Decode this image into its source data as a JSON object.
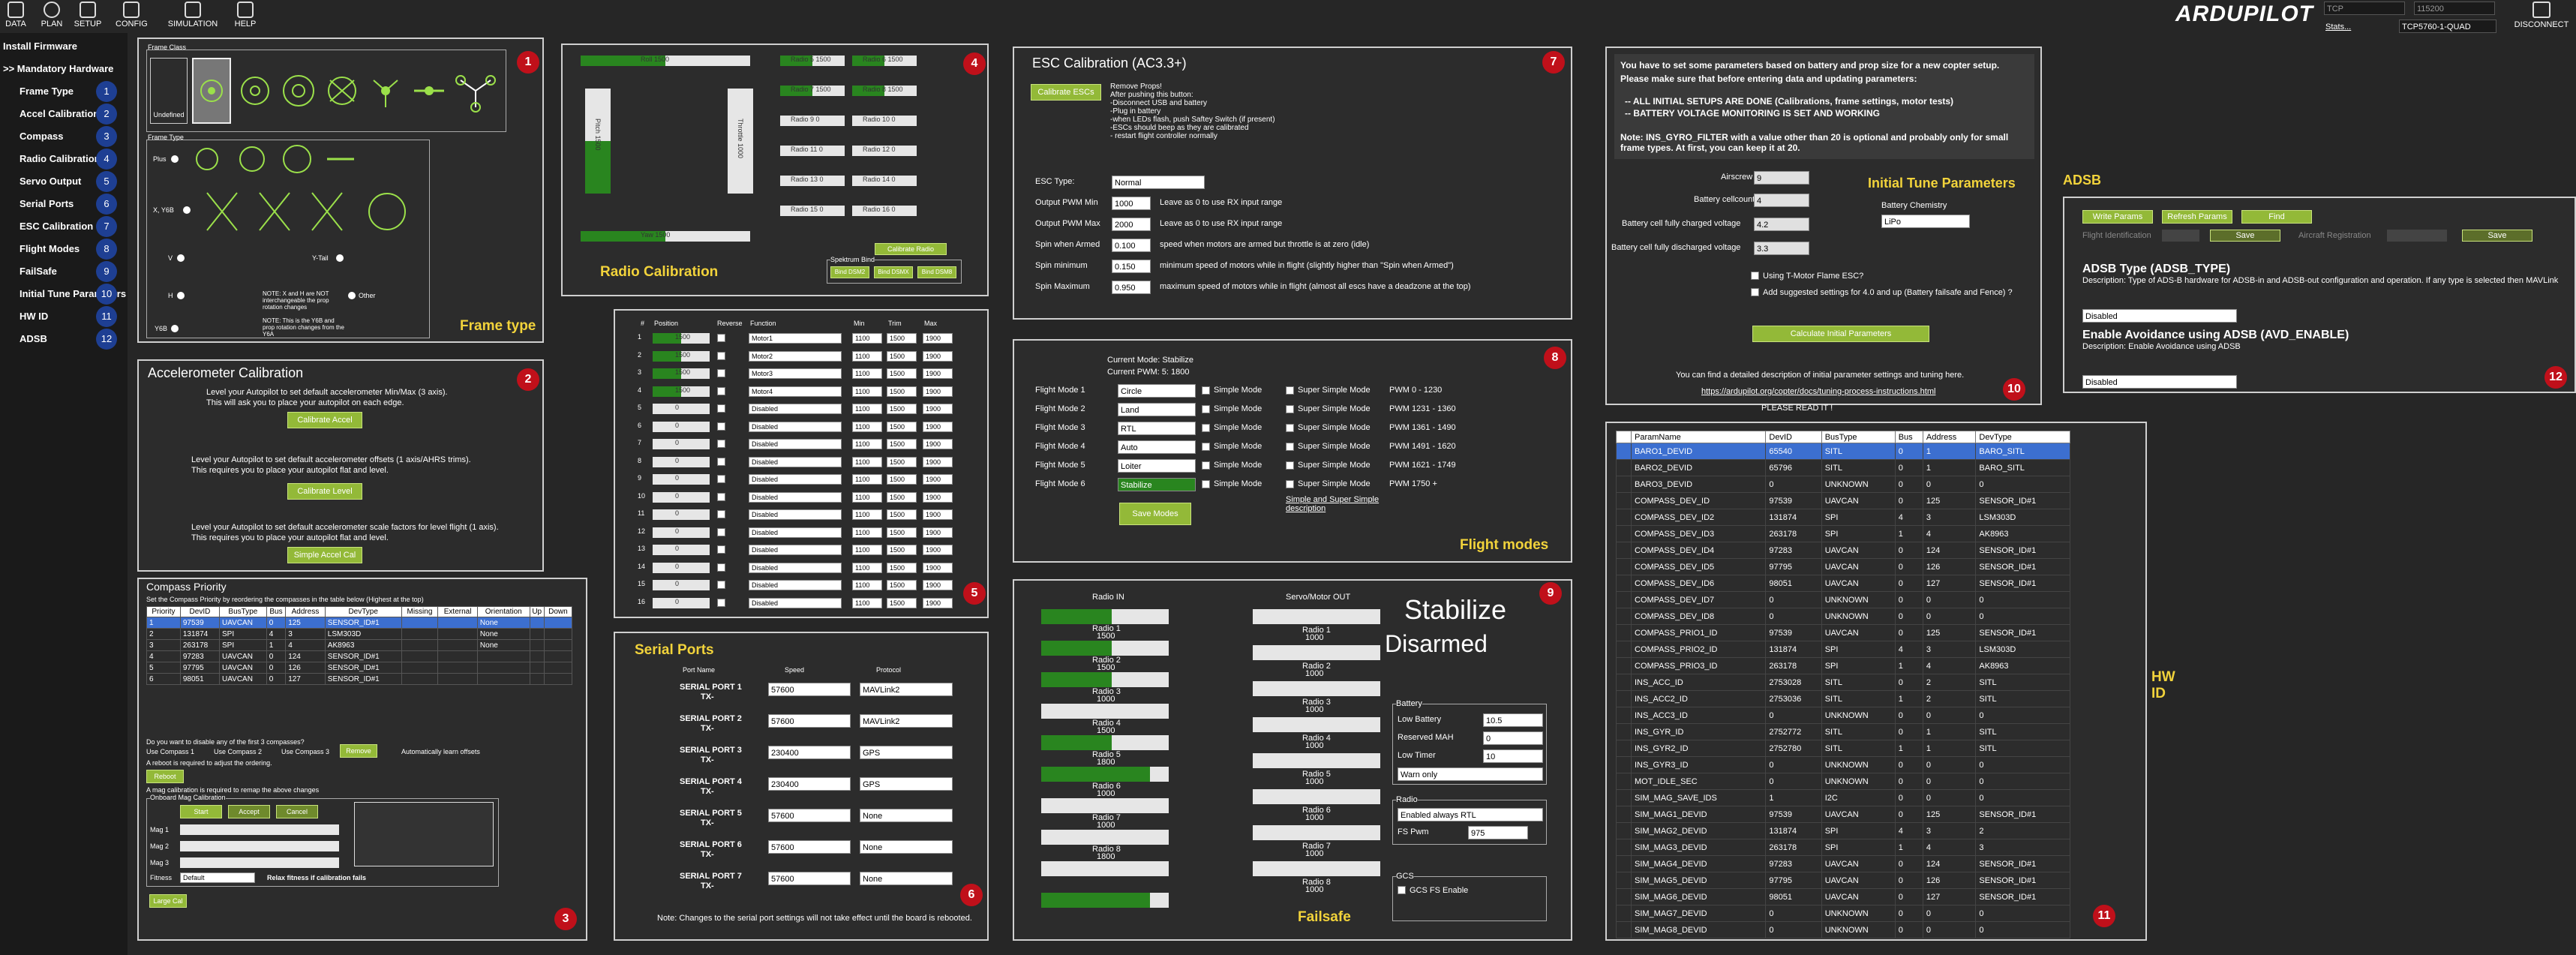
{
  "topbar": {
    "items": [
      {
        "label": "DATA"
      },
      {
        "label": "PLAN"
      },
      {
        "label": "SETUP"
      },
      {
        "label": "CONFIG"
      },
      {
        "label": "SIMULATION"
      },
      {
        "label": "HELP"
      }
    ],
    "logo": "ARDUPILOT",
    "conn_type": "TCP",
    "baud": "115200",
    "link": "TCP5760-1-QUAD",
    "stats": "Stats...",
    "disconnect": "DISCONNECT"
  },
  "leftnav": [
    {
      "label": "Install Firmware",
      "num": ""
    },
    {
      "label": ">> Mandatory Hardware",
      "num": ""
    },
    {
      "label": "Frame Type",
      "num": "1"
    },
    {
      "label": "Accel Calibration",
      "num": "2"
    },
    {
      "label": "Compass",
      "num": "3"
    },
    {
      "label": "Radio Calibration",
      "num": "4"
    },
    {
      "label": "Servo Output",
      "num": "5"
    },
    {
      "label": "Serial Ports",
      "num": "6"
    },
    {
      "label": "ESC Calibration",
      "num": "7"
    },
    {
      "label": "Flight Modes",
      "num": "8"
    },
    {
      "label": "FailSafe",
      "num": "9"
    },
    {
      "label": "Initial Tune Parameters",
      "num": "10"
    },
    {
      "label": "HW ID",
      "num": "11"
    },
    {
      "label": "ADSB",
      "num": "12"
    }
  ],
  "frame": {
    "title": "Frame type",
    "class_label": "Frame Class",
    "type_label": "Frame Type",
    "undefined": "Undefined",
    "plus": "Plus",
    "x": "X, Y6B",
    "v": "V",
    "vtail": "Y-Tail",
    "h": "H",
    "other": "Other",
    "y6b": "Y6B",
    "note1": "NOTE: X and H are NOT interchangeable the prop rotation changes",
    "note2": "NOTE: This is the Y6B and prop rotation changes from the Y6A",
    "num": "1"
  },
  "accel": {
    "title": "Accelerometer Calibration",
    "t1a": "Level your Autopilot to set default accelerometer Min/Max (3 axis).",
    "t1b": "This will ask you to place your autopilot on each edge.",
    "b1": "Calibrate Accel",
    "t2a": "Level your Autopilot to set default accelerometer offsets (1 axis/AHRS trims).",
    "t2b": "This requires you to place your autopilot flat and level.",
    "b2": "Calibrate Level",
    "t3a": "Level your Autopilot to set default accelerometer scale factors for level flight (1 axis).",
    "t3b": "This requires you to place your autopilot flat and level.",
    "b3": "Simple Accel Cal",
    "num": "2"
  },
  "compass": {
    "title": "Compass Priority",
    "desc": "Set the Compass Priority by reordering the compasses in the table below (Highest at the top)",
    "headers": [
      "Priority",
      "DevID",
      "BusType",
      "Bus",
      "Address",
      "DevType",
      "Missing",
      "External",
      "Orientation",
      "Up",
      "Down"
    ],
    "rows": [
      [
        "1",
        "97539",
        "UAVCAN",
        "0",
        "125",
        "SENSOR_ID#1",
        "",
        "",
        "None"
      ],
      [
        "2",
        "131874",
        "SPI",
        "4",
        "3",
        "LSM303D",
        "",
        "",
        "None"
      ],
      [
        "3",
        "263178",
        "SPI",
        "1",
        "4",
        "AK8963",
        "",
        "",
        "None"
      ],
      [
        "4",
        "97283",
        "UAVCAN",
        "0",
        "124",
        "SENSOR_ID#1",
        "",
        "",
        ""
      ],
      [
        "5",
        "97795",
        "UAVCAN",
        "0",
        "126",
        "SENSOR_ID#1",
        "",
        "",
        ""
      ],
      [
        "6",
        "98051",
        "UAVCAN",
        "0",
        "127",
        "SENSOR_ID#1",
        "",
        "",
        ""
      ]
    ],
    "q": "Do you want to disable any of the first 3 compasses?",
    "uc1": "Use Compass 1",
    "uc2": "Use Compass 2",
    "uc3": "Use Compass 3",
    "remove": "Remove",
    "autolearn": "Automatically learn offsets",
    "reboot_note": "A reboot is required to adjust the ordering.",
    "reboot": "Reboot",
    "mag_note": "A mag calibration is required to remap the above changes",
    "onboard": "Onboard Mag Calibration",
    "start": "Start",
    "accept": "Accept",
    "cancel": "Cancel",
    "mag1": "Mag 1",
    "mag2": "Mag 2",
    "mag3": "Mag 3",
    "fitness_label": "Fitness",
    "fitness": "Default",
    "relax": "Relax fitness if calibration fails",
    "largecal": "Large Cal",
    "num": "3"
  },
  "radio": {
    "title": "Radio Calibration",
    "roll": "Roll 1500",
    "pitch": "Pitch 1500",
    "throttle": "Throttle 1000",
    "yaw": "Yaw 1500",
    "radios": [
      "Radio 5 1500",
      "Radio 6 1500",
      "Radio 7 1500",
      "Radio 8 1500",
      "Radio 9 0",
      "Radio 10 0",
      "Radio 11 0",
      "Radio 12 0",
      "Radio 13 0",
      "Radio 14 0",
      "Radio 15 0",
      "Radio 16 0"
    ],
    "calibrate": "Calibrate Radio",
    "spektrum": "Spektrum Bind",
    "dsm2": "Bind DSM2",
    "dsmx": "Bind DSMX",
    "dsm8": "Bind DSM8",
    "num": "4"
  },
  "servo": {
    "headers": [
      "#",
      "Position",
      "Reverse",
      "Function",
      "Min",
      "Trim",
      "Max"
    ],
    "rows": [
      [
        "1",
        "1500",
        "Motor1",
        "1100",
        "1500",
        "1900"
      ],
      [
        "2",
        "1500",
        "Motor2",
        "1100",
        "1500",
        "1900"
      ],
      [
        "3",
        "1500",
        "Motor3",
        "1100",
        "1500",
        "1900"
      ],
      [
        "4",
        "1500",
        "Motor4",
        "1100",
        "1500",
        "1900"
      ],
      [
        "5",
        "0",
        "Disabled",
        "1100",
        "1500",
        "1900"
      ],
      [
        "6",
        "0",
        "Disabled",
        "1100",
        "1500",
        "1900"
      ],
      [
        "7",
        "0",
        "Disabled",
        "1100",
        "1500",
        "1900"
      ],
      [
        "8",
        "0",
        "Disabled",
        "1100",
        "1500",
        "1900"
      ],
      [
        "9",
        "0",
        "Disabled",
        "1100",
        "1500",
        "1900"
      ],
      [
        "10",
        "0",
        "Disabled",
        "1100",
        "1500",
        "1900"
      ],
      [
        "11",
        "0",
        "Disabled",
        "1100",
        "1500",
        "1900"
      ],
      [
        "12",
        "0",
        "Disabled",
        "1100",
        "1500",
        "1900"
      ],
      [
        "13",
        "0",
        "Disabled",
        "1100",
        "1500",
        "1900"
      ],
      [
        "14",
        "0",
        "Disabled",
        "1100",
        "1500",
        "1900"
      ],
      [
        "15",
        "0",
        "Disabled",
        "1100",
        "1500",
        "1900"
      ],
      [
        "16",
        "0",
        "Disabled",
        "1100",
        "1500",
        "1900"
      ]
    ],
    "num": "5"
  },
  "serial": {
    "title": "Serial Ports",
    "h_port": "Port Name",
    "h_speed": "Speed",
    "h_proto": "Protocol",
    "rows": [
      [
        "SERIAL PORT 1",
        "TX-",
        "57600",
        "MAVLink2"
      ],
      [
        "SERIAL PORT 2",
        "TX-",
        "57600",
        "MAVLink2"
      ],
      [
        "SERIAL PORT 3",
        "TX-",
        "230400",
        "GPS"
      ],
      [
        "SERIAL PORT 4",
        "TX-",
        "230400",
        "GPS"
      ],
      [
        "SERIAL PORT 5",
        "TX-",
        "57600",
        "None"
      ],
      [
        "SERIAL PORT 6",
        "TX-",
        "57600",
        "None"
      ],
      [
        "SERIAL PORT 7",
        "TX-",
        "57600",
        "None"
      ]
    ],
    "note": "Note: Changes to the serial port settings will not take effect until the board is rebooted.",
    "num": "6"
  },
  "esc": {
    "title": "ESC Calibration (AC3.3+)",
    "btn": "Calibrate ESCs",
    "steps": [
      "Remove Props!",
      "After pushing this button:",
      "-Disconnect USB and battery",
      "-Plug in battery",
      "-when LEDs flash, push Saftey Switch (if present)",
      "-ESCs should beep as they are calibrated",
      "- restart flight controller normally"
    ],
    "type_label": "ESC Type:",
    "type": "Normal",
    "rows": [
      [
        "Output PWM Min",
        "1000",
        "Leave as 0 to use RX input range"
      ],
      [
        "Output PWM Max",
        "2000",
        "Leave as 0 to use RX input range"
      ],
      [
        "Spin when Armed",
        "0.100",
        "speed when motors are armed but throttle is at zero (idle)"
      ],
      [
        "Spin minimum",
        "0.150",
        "minimum speed of motors while in flight (slightly higher than \"Spin when Armed\")"
      ],
      [
        "Spin Maximum",
        "0.950",
        "maximum speed of motors while in flight (almost all escs have a deadzone at the top)"
      ]
    ],
    "num": "7"
  },
  "fm": {
    "title": "Flight modes",
    "cur_mode": "Current Mode:  Stabilize",
    "cur_pwm": "Current PWM:   5: 1800",
    "modes": [
      [
        "Flight Mode 1",
        "Circle",
        "PWM 0 - 1230"
      ],
      [
        "Flight Mode 2",
        "Land",
        "PWM 1231 - 1360"
      ],
      [
        "Flight Mode 3",
        "RTL",
        "PWM 1361 - 1490"
      ],
      [
        "Flight Mode 4",
        "Auto",
        "PWM 1491 - 1620"
      ],
      [
        "Flight Mode 5",
        "Loiter",
        "PWM 1621 - 1749"
      ],
      [
        "Flight Mode 6",
        "Stabilize",
        "PWM 1750 +"
      ]
    ],
    "simple": "Simple Mode",
    "super": "Super Simple Mode",
    "save": "Save Modes",
    "link": "Simple and Super Simple description",
    "num": "8"
  },
  "fs": {
    "title": "Failsafe",
    "radio_in": "Radio IN",
    "servo_out": "Servo/Motor OUT",
    "radios": [
      [
        "Radio 1",
        "1500"
      ],
      [
        "Radio 2",
        "1500"
      ],
      [
        "Radio 3",
        "1000"
      ],
      [
        "Radio 4",
        "1500"
      ],
      [
        "Radio 5",
        "1800"
      ],
      [
        "Radio 6",
        "1000"
      ],
      [
        "Radio 7",
        "1000"
      ],
      [
        "Radio 8",
        "1800"
      ]
    ],
    "radios_in_fill": [
      0.55,
      0.55,
      0.55,
      0.0,
      0.55,
      0.85,
      0.0,
      0.0,
      0.0,
      0.85
    ],
    "servos": [
      [
        "Radio 1",
        "1000"
      ],
      [
        "Radio 2",
        "1000"
      ],
      [
        "Radio 3",
        "1000"
      ],
      [
        "Radio 4",
        "1000"
      ],
      [
        "Radio 5",
        "1000"
      ],
      [
        "Radio 6",
        "1000"
      ],
      [
        "Radio 7",
        "1000"
      ],
      [
        "Radio 8",
        "1000"
      ]
    ],
    "mode": "Stabilize",
    "armed": "Disarmed",
    "battery": "Battery",
    "low_battery": "Low Battery",
    "low_val": "10.5",
    "reserved": "Reserved MAH",
    "reserved_val": "0",
    "low_timer": "Low Timer",
    "low_timer_val": "10",
    "warn": "Warn only",
    "radio": "Radio",
    "radio_sel": "Enabled always RTL",
    "fs_pwm": "FS Pwm",
    "fs_pwm_val": "975",
    "gcs": "GCS",
    "gcs_enable": "GCS FS Enable",
    "num": "9"
  },
  "itp": {
    "title": "Initial Tune Parameters",
    "info": "You have to set some parameters based on battery and prop size for a new copter setup.",
    "info2": "Please make sure that before entering data and updating parameters:",
    "b1": "-- ALL INITIAL SETUPS ARE DONE (Calibrations, frame settings, motor tests)",
    "b2": "-- BATTERY VOLTAGE MONITORING IS SET AND WORKING",
    "note": "Note: INS_GYRO_FILTER with a value other than 20 is optional and probably only for small frame types. At first, you can keep it at 20.",
    "airscrew": "Airscrew size in inch",
    "airscrew_v": "9",
    "cells": "Battery cellcount",
    "cells_v": "4",
    "full": "Battery cell fully charged voltage",
    "full_v": "4.2",
    "disch": "Battery cell fully discharged voltage",
    "disch_v": "3.3",
    "chem": "Battery Chemistry",
    "chem_v": "LiPo",
    "tmotor": "Using T-Motor Flame ESC?",
    "suggested": "Add suggested settings for 4.0 and up (Battery failsafe and Fence) ?",
    "calc": "Calculate Initial Parameters",
    "desc": "You can find a detailed description of initial parameter settings and tuning here.",
    "url": "https://ardupilot.org/copter/docs/tuning-process-instructions.html",
    "read": "PLEASE READ IT !",
    "num": "10"
  },
  "hwid": {
    "title": "HW ID",
    "headers": [
      "ParamName",
      "DevID",
      "BusType",
      "Bus",
      "Address",
      "DevType"
    ],
    "rows": [
      [
        "BARO1_DEVID",
        "65540",
        "SITL",
        "0",
        "1",
        "BARO_SITL"
      ],
      [
        "BARO2_DEVID",
        "65796",
        "SITL",
        "0",
        "1",
        "BARO_SITL"
      ],
      [
        "BARO3_DEVID",
        "0",
        "UNKNOWN",
        "0",
        "0",
        "0"
      ],
      [
        "COMPASS_DEV_ID",
        "97539",
        "UAVCAN",
        "0",
        "125",
        "SENSOR_ID#1"
      ],
      [
        "COMPASS_DEV_ID2",
        "131874",
        "SPI",
        "4",
        "3",
        "LSM303D"
      ],
      [
        "COMPASS_DEV_ID3",
        "263178",
        "SPI",
        "1",
        "4",
        "AK8963"
      ],
      [
        "COMPASS_DEV_ID4",
        "97283",
        "UAVCAN",
        "0",
        "124",
        "SENSOR_ID#1"
      ],
      [
        "COMPASS_DEV_ID5",
        "97795",
        "UAVCAN",
        "0",
        "126",
        "SENSOR_ID#1"
      ],
      [
        "COMPASS_DEV_ID6",
        "98051",
        "UAVCAN",
        "0",
        "127",
        "SENSOR_ID#1"
      ],
      [
        "COMPASS_DEV_ID7",
        "0",
        "UNKNOWN",
        "0",
        "0",
        "0"
      ],
      [
        "COMPASS_DEV_ID8",
        "0",
        "UNKNOWN",
        "0",
        "0",
        "0"
      ],
      [
        "COMPASS_PRIO1_ID",
        "97539",
        "UAVCAN",
        "0",
        "125",
        "SENSOR_ID#1"
      ],
      [
        "COMPASS_PRIO2_ID",
        "131874",
        "SPI",
        "4",
        "3",
        "LSM303D"
      ],
      [
        "COMPASS_PRIO3_ID",
        "263178",
        "SPI",
        "1",
        "4",
        "AK8963"
      ],
      [
        "INS_ACC_ID",
        "2753028",
        "SITL",
        "0",
        "2",
        "SITL"
      ],
      [
        "INS_ACC2_ID",
        "2753036",
        "SITL",
        "1",
        "2",
        "SITL"
      ],
      [
        "INS_ACC3_ID",
        "0",
        "UNKNOWN",
        "0",
        "0",
        "0"
      ],
      [
        "INS_GYR_ID",
        "2752772",
        "SITL",
        "0",
        "1",
        "SITL"
      ],
      [
        "INS_GYR2_ID",
        "2752780",
        "SITL",
        "1",
        "1",
        "SITL"
      ],
      [
        "INS_GYR3_ID",
        "0",
        "UNKNOWN",
        "0",
        "0",
        "0"
      ],
      [
        "MOT_IDLE_SEC",
        "0",
        "UNKNOWN",
        "0",
        "0",
        "0"
      ],
      [
        "SIM_MAG_SAVE_IDS",
        "1",
        "I2C",
        "0",
        "0",
        "0"
      ],
      [
        "SIM_MAG1_DEVID",
        "97539",
        "UAVCAN",
        "0",
        "125",
        "SENSOR_ID#1"
      ],
      [
        "SIM_MAG2_DEVID",
        "131874",
        "SPI",
        "4",
        "3",
        "2"
      ],
      [
        "SIM_MAG3_DEVID",
        "263178",
        "SPI",
        "1",
        "4",
        "3"
      ],
      [
        "SIM_MAG4_DEVID",
        "97283",
        "UAVCAN",
        "0",
        "124",
        "SENSOR_ID#1"
      ],
      [
        "SIM_MAG5_DEVID",
        "97795",
        "UAVCAN",
        "0",
        "126",
        "SENSOR_ID#1"
      ],
      [
        "SIM_MAG6_DEVID",
        "98051",
        "UAVCAN",
        "0",
        "127",
        "SENSOR_ID#1"
      ],
      [
        "SIM_MAG7_DEVID",
        "0",
        "UNKNOWN",
        "0",
        "0",
        "0"
      ],
      [
        "SIM_MAG8_DEVID",
        "0",
        "UNKNOWN",
        "0",
        "0",
        "0"
      ]
    ],
    "num": "11"
  },
  "adsb": {
    "title": "ADSB",
    "write": "Write Params",
    "refresh": "Refresh Params",
    "find": "Find",
    "flight_id": "Flight Identification",
    "save": "Save",
    "aircraft_reg": "Aircraft Registration",
    "save2": "Save",
    "type_title": "ADSB Type (ADSB_TYPE)",
    "type_desc": "Description: Type of ADS-B hardware for ADSB-in and ADSB-out configuration and operation. If any type is selected then MAVLink",
    "type_val": "Disabled",
    "avd_title": "Enable Avoidance using ADSB (AVD_ENABLE)",
    "avd_desc": "Description: Enable Avoidance using ADSB",
    "avd_val": "Disabled",
    "num": "12"
  }
}
